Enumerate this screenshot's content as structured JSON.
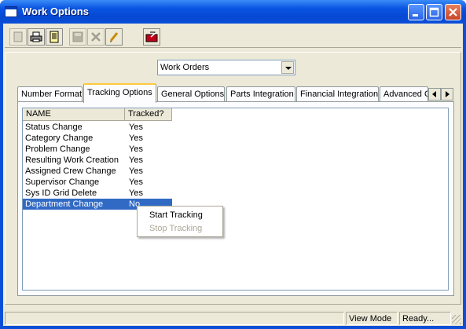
{
  "window": {
    "title": "Work Options"
  },
  "toolbar": {
    "buttons": [
      {
        "icon": "new-document-icon",
        "enabled": false
      },
      {
        "icon": "print-icon",
        "enabled": true
      },
      {
        "icon": "print-preview-icon",
        "enabled": true
      },
      {
        "icon": "save-icon",
        "enabled": false
      },
      {
        "icon": "delete-icon",
        "enabled": false
      },
      {
        "icon": "edit-pencil-icon",
        "enabled": true
      },
      {
        "icon": "exit-icon",
        "enabled": true
      }
    ]
  },
  "module_select": {
    "value": "Work Orders"
  },
  "tabs": [
    "Number Format",
    "Tracking Options",
    "General Options",
    "Parts Integration",
    "Financial Integration",
    "Advanced O"
  ],
  "active_tab": "Tracking Options",
  "grid": {
    "columns": [
      "NAME",
      "Tracked?"
    ],
    "rows": [
      {
        "name": "Status Change",
        "tracked": "Yes"
      },
      {
        "name": "Category Change",
        "tracked": "Yes"
      },
      {
        "name": "Problem Change",
        "tracked": "Yes"
      },
      {
        "name": "Resulting Work Creation",
        "tracked": "Yes"
      },
      {
        "name": "Assigned Crew Change",
        "tracked": "Yes"
      },
      {
        "name": "Supervisor Change",
        "tracked": "Yes"
      },
      {
        "name": "Sys ID Grid Delete",
        "tracked": "Yes"
      },
      {
        "name": "Department Change",
        "tracked": "No"
      }
    ],
    "selected_row": "Department Change"
  },
  "context_menu": {
    "items": [
      {
        "label": "Start Tracking",
        "enabled": true
      },
      {
        "label": "Stop Tracking",
        "enabled": false
      }
    ]
  },
  "statusbar": {
    "main": "",
    "mode": "View Mode",
    "state": "Ready..."
  },
  "colors": {
    "titlebar": "#0a55e3",
    "selection": "#316ac5",
    "face": "#ece9d8"
  }
}
